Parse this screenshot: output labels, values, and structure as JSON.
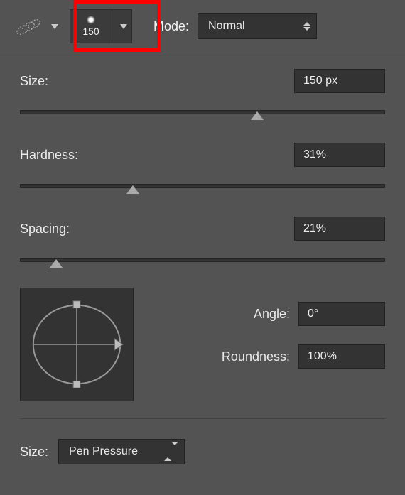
{
  "toolbar": {
    "brush_preset_value": "150",
    "mode_label": "Mode:",
    "mode_value": "Normal"
  },
  "size": {
    "label": "Size:",
    "value": "150 px",
    "pct": 65
  },
  "hardness": {
    "label": "Hardness:",
    "value": "31%",
    "pct": 31
  },
  "spacing": {
    "label": "Spacing:",
    "value": "21%",
    "pct": 10
  },
  "angle": {
    "angle_label": "Angle:",
    "angle_value": "0°",
    "roundness_label": "Roundness:",
    "roundness_value": "100%"
  },
  "dynamics": {
    "size_label": "Size:",
    "size_value": "Pen Pressure"
  }
}
